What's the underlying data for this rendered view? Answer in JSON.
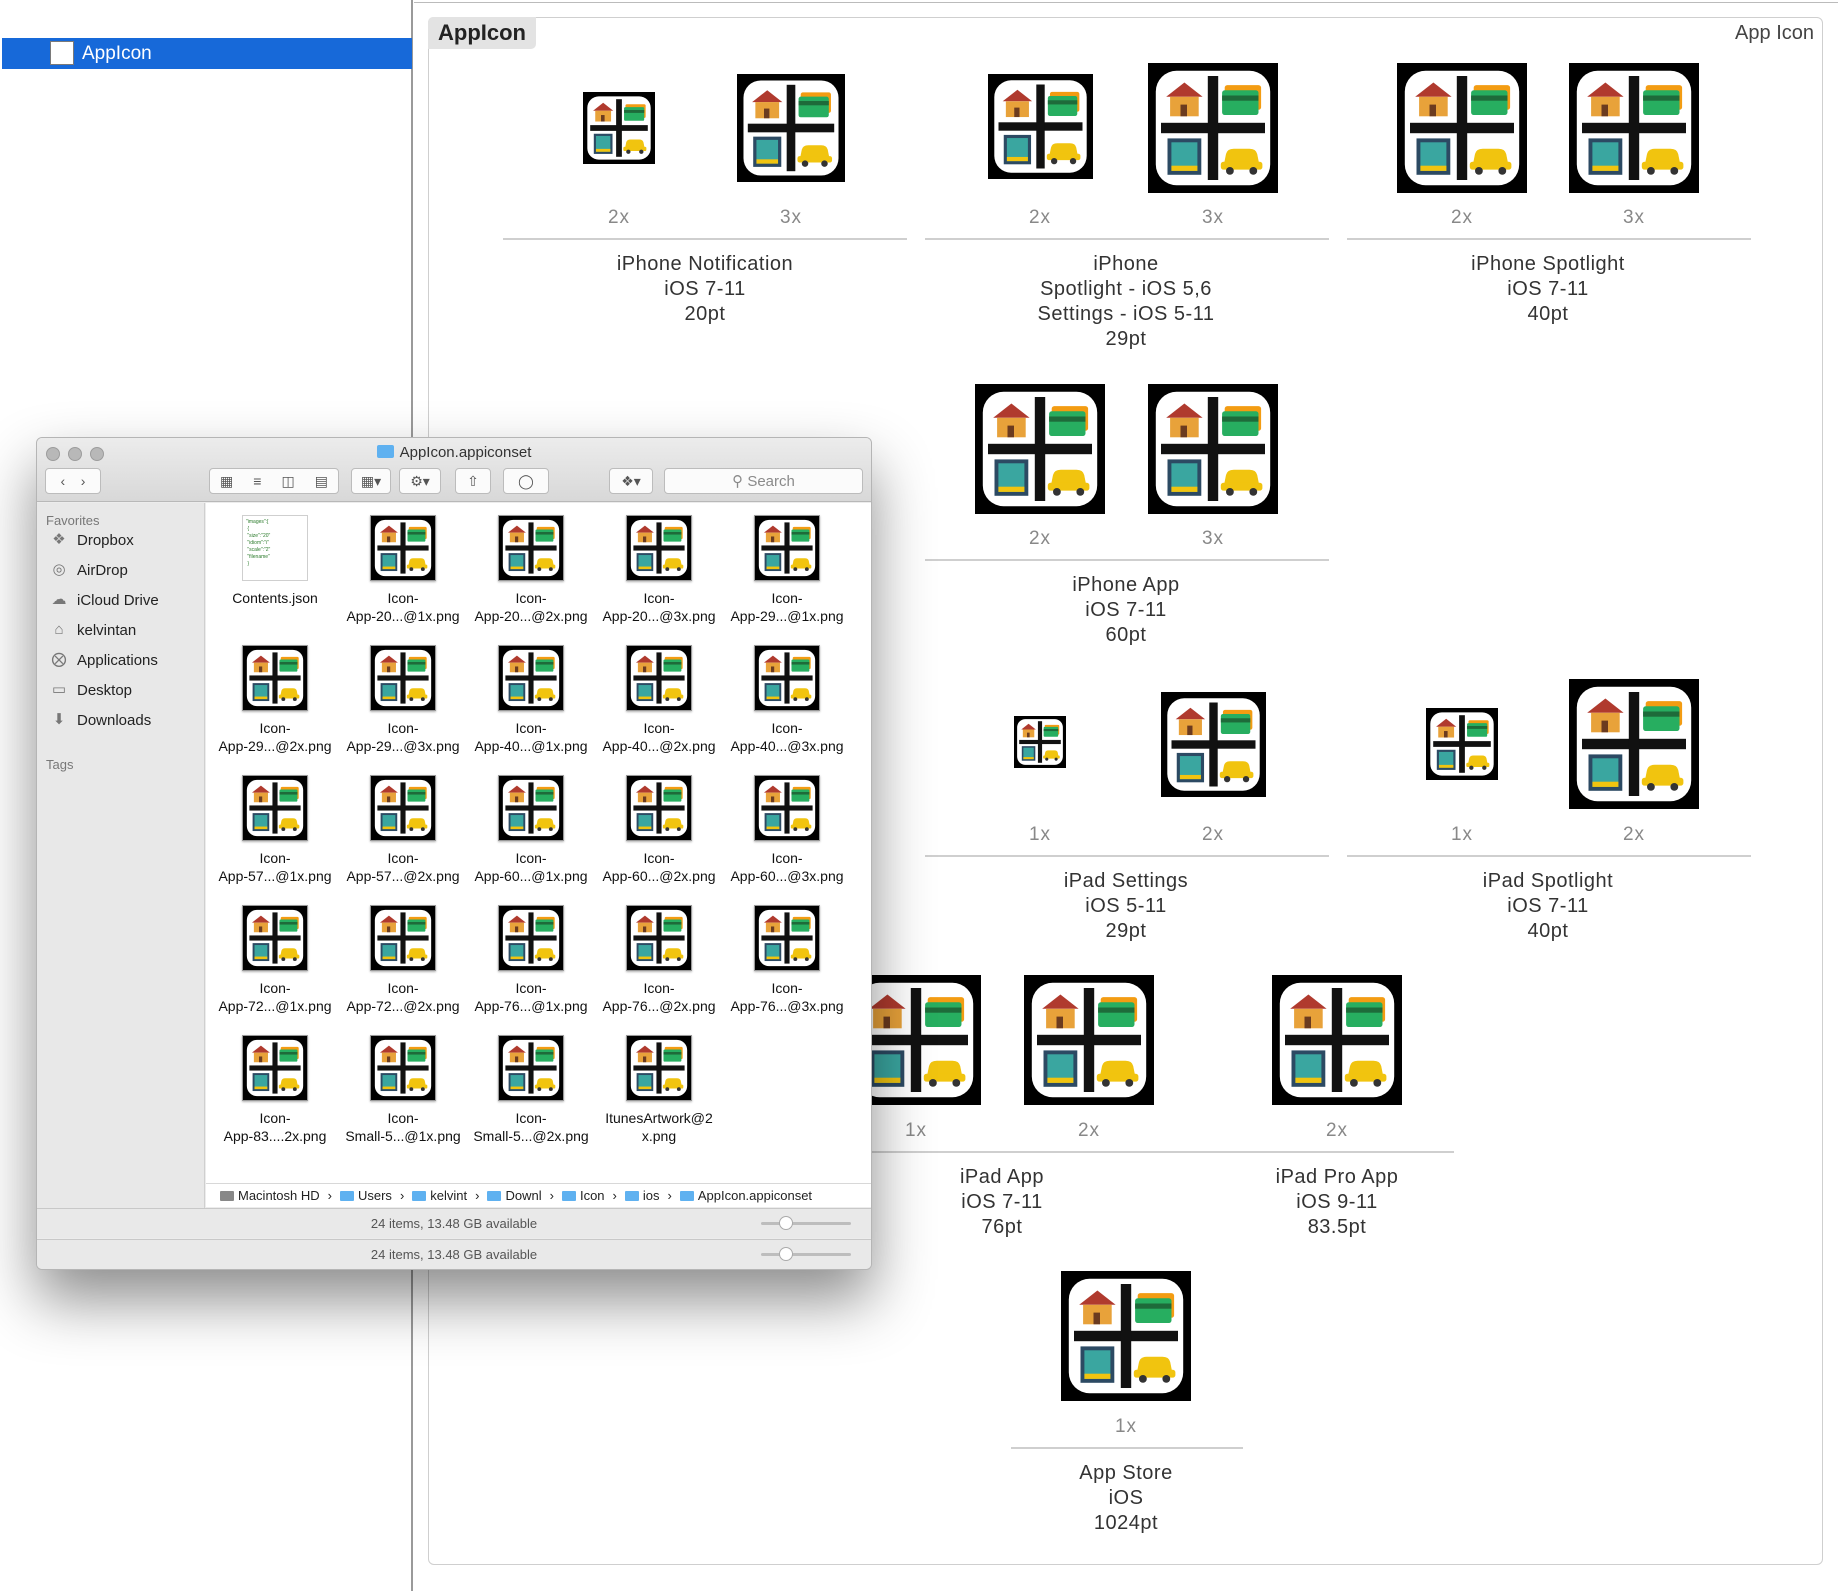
{
  "sidebar": {
    "selected_item": "AppIcon"
  },
  "panel": {
    "tab_title": "AppIcon",
    "type_label": "App Icon"
  },
  "groups": {
    "iphone_notification": {
      "scales": [
        "2x",
        "3x"
      ],
      "label_lines": [
        "iPhone Notification",
        "iOS 7-11",
        "20pt"
      ]
    },
    "iphone_spotlight_settings": {
      "scales": [
        "2x",
        "3x"
      ],
      "label_lines": [
        "iPhone",
        "Spotlight - iOS 5,6",
        "Settings - iOS 5-11",
        "29pt"
      ]
    },
    "iphone_spotlight": {
      "scales": [
        "2x",
        "3x"
      ],
      "label_lines": [
        "iPhone Spotlight",
        "iOS 7-11",
        "40pt"
      ]
    },
    "iphone_app": {
      "scales": [
        "2x",
        "3x"
      ],
      "label_lines": [
        "iPhone App",
        "iOS 7-11",
        "60pt"
      ]
    },
    "ipad_settings": {
      "scales": [
        "1x",
        "2x"
      ],
      "label_lines": [
        "iPad Settings",
        "iOS 5-11",
        "29pt"
      ]
    },
    "ipad_spotlight": {
      "scales": [
        "1x",
        "2x"
      ],
      "label_lines": [
        "iPad Spotlight",
        "iOS 7-11",
        "40pt"
      ]
    },
    "ipad_app": {
      "scales": [
        "1x",
        "2x"
      ],
      "label_lines": [
        "iPad App",
        "iOS 7-11",
        "76pt"
      ]
    },
    "ipad_pro_app": {
      "scales": [
        "2x"
      ],
      "label_lines": [
        "iPad Pro App",
        "iOS 9-11",
        "83.5pt"
      ]
    },
    "app_store": {
      "scales": [
        "1x"
      ],
      "label_lines": [
        "App Store",
        "iOS",
        "1024pt"
      ]
    }
  },
  "finder": {
    "title": "AppIcon.appiconset",
    "search_placeholder": "Search",
    "sidebar_header_favorites": "Favorites",
    "sidebar_header_tags": "Tags",
    "favorites": [
      "Dropbox",
      "AirDrop",
      "iCloud Drive",
      "kelvintan",
      "Applications",
      "Desktop",
      "Downloads"
    ],
    "favorite_icons": [
      "dropbox-icon",
      "airdrop-icon",
      "icloud-icon",
      "home-icon",
      "applications-icon",
      "desktop-icon",
      "downloads-icon"
    ],
    "files": [
      {
        "l1": "Contents.json",
        "l2": ""
      },
      {
        "l1": "Icon-",
        "l2": "App-20...@1x.png"
      },
      {
        "l1": "Icon-",
        "l2": "App-20...@2x.png"
      },
      {
        "l1": "Icon-",
        "l2": "App-20...@3x.png"
      },
      {
        "l1": "Icon-",
        "l2": "App-29...@1x.png"
      },
      {
        "l1": "Icon-",
        "l2": "App-29...@2x.png"
      },
      {
        "l1": "Icon-",
        "l2": "App-29...@3x.png"
      },
      {
        "l1": "Icon-",
        "l2": "App-40...@1x.png"
      },
      {
        "l1": "Icon-",
        "l2": "App-40...@2x.png"
      },
      {
        "l1": "Icon-",
        "l2": "App-40...@3x.png"
      },
      {
        "l1": "Icon-",
        "l2": "App-57...@1x.png"
      },
      {
        "l1": "Icon-",
        "l2": "App-57...@2x.png"
      },
      {
        "l1": "Icon-",
        "l2": "App-60...@1x.png"
      },
      {
        "l1": "Icon-",
        "l2": "App-60...@2x.png"
      },
      {
        "l1": "Icon-",
        "l2": "App-60...@3x.png"
      },
      {
        "l1": "Icon-",
        "l2": "App-72...@1x.png"
      },
      {
        "l1": "Icon-",
        "l2": "App-72...@2x.png"
      },
      {
        "l1": "Icon-",
        "l2": "App-76...@1x.png"
      },
      {
        "l1": "Icon-",
        "l2": "App-76...@2x.png"
      },
      {
        "l1": "Icon-",
        "l2": "App-76...@3x.png"
      },
      {
        "l1": "Icon-",
        "l2": "App-83....2x.png"
      },
      {
        "l1": "Icon-",
        "l2": "Small-5...@1x.png"
      },
      {
        "l1": "Icon-",
        "l2": "Small-5...@2x.png"
      },
      {
        "l1": "ItunesArtwork@2",
        "l2": "x.png"
      }
    ],
    "path": [
      "Macintosh HD",
      "Users",
      "kelvint",
      "Downl",
      "Icon",
      "ios",
      "AppIcon.appiconset"
    ],
    "status": "24 items, 13.48 GB available",
    "status_dup": "24 items, 13.48 GB available"
  }
}
